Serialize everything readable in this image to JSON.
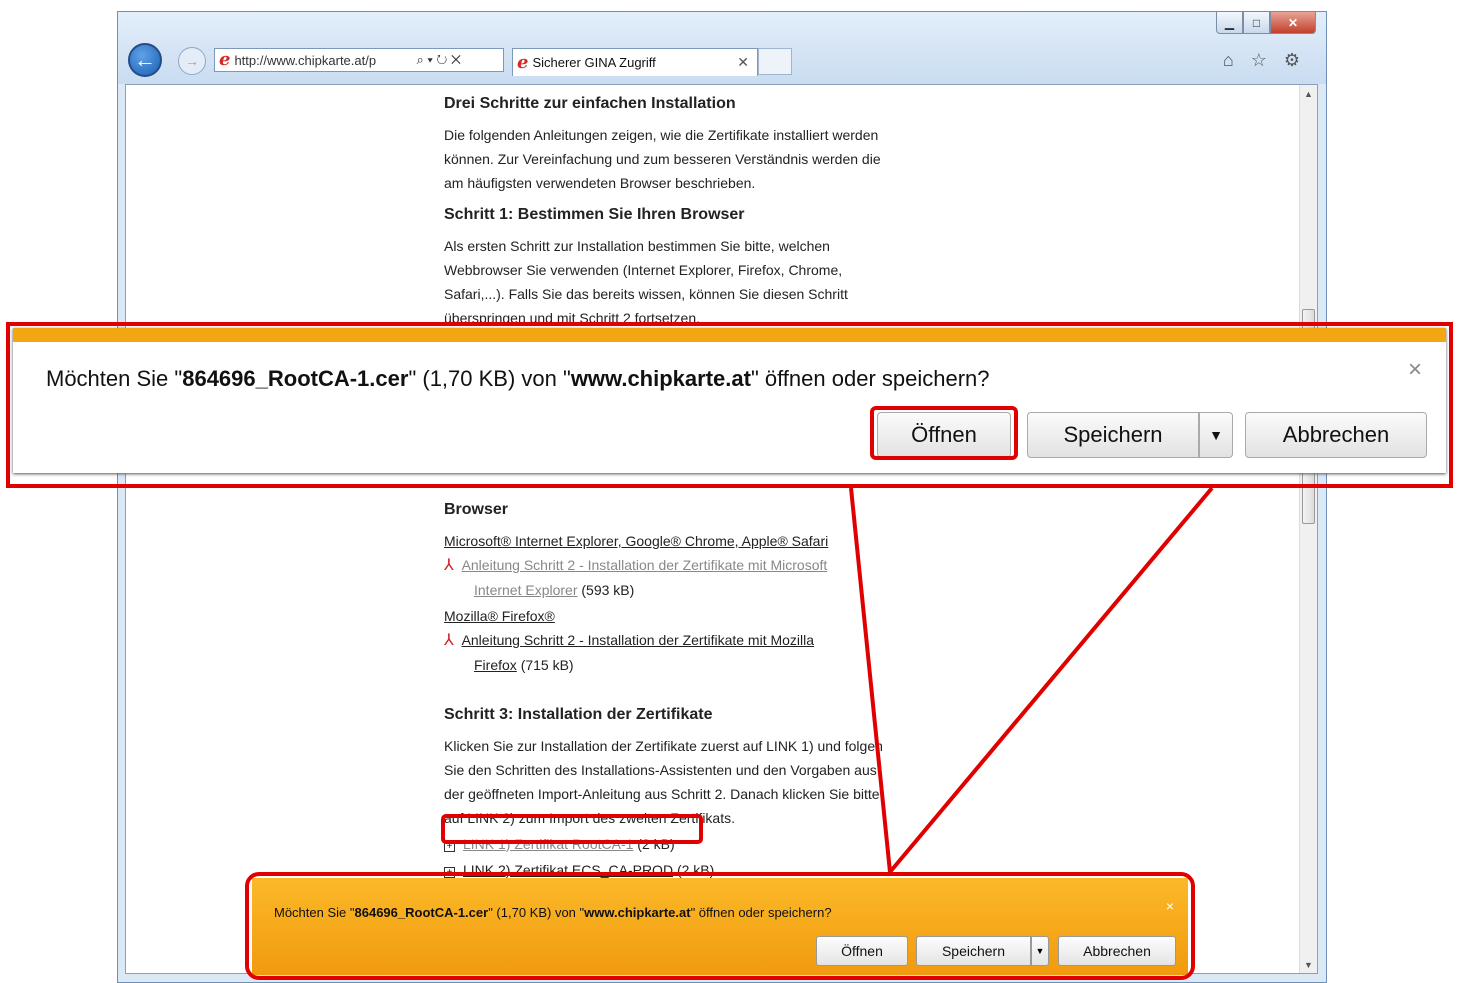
{
  "browser": {
    "url": "http://www.chipkarte.at/p",
    "tab_title": "Sicherer GINA Zugriff",
    "url_icons": "⌕ ▾ ↻ ✕",
    "tool_icons": "⌂ ☆ ⚙"
  },
  "page": {
    "heading_install": "Drei Schritte zur einfachen Installation",
    "intro": [
      "Die folgenden Anleitungen zeigen, wie die Zertifikate installiert werden",
      "können. Zur Vereinfachung und zum besseren Verständnis werden die",
      "am häufigsten verwendeten Browser beschrieben."
    ],
    "step1_heading": "Schritt 1: Bestimmen Sie Ihren Browser",
    "step1_text": [
      "Als ersten Schritt zur Installation bestimmen Sie bitte, welchen",
      "Webbrowser Sie verwenden (Internet Explorer, Firefox, Chrome,",
      "Safari,...). Falls Sie das bereits wissen, können Sie diesen Schritt",
      "überspringen und mit Schritt 2 fortsetzen."
    ],
    "browser_heading": "Browser",
    "ms_browsers": "Microsoft® Internet Explorer, Google® Chrome, Apple® Safari",
    "ms_guide_link_1": "Anleitung Schritt 2 - Installation der Zertifikate mit Microsoft",
    "ms_guide_link_2": "Internet Explorer",
    "ms_guide_size": "(593 kB)",
    "firefox_browser": "Mozilla® Firefox®",
    "ff_guide_link_1": "Anleitung Schritt 2 - Installation der Zertifikate mit Mozilla",
    "ff_guide_link_2": "Firefox",
    "ff_guide_size": "(715 kB)",
    "step3_heading": "Schritt 3: Installation der Zertifikate",
    "step3_text": [
      "Klicken Sie zur Installation der Zertifikate zuerst auf LINK 1) und folgen",
      "Sie den Schritten des Installations-Assistenten und den Vorgaben aus",
      "der geöffneten Import-Anleitung aus Schritt 2. Danach klicken Sie bitte",
      "auf LINK 2) zum Import des zweiten Zertifikats."
    ],
    "link1": "LINK 1) Zertifikat RootCA-1",
    "link1_size": "(2 kB)",
    "link2": "LINK 2) Zertifikat ECS_CA-PROD",
    "link2_size": "(2 kB)"
  },
  "download_prompt": {
    "prefix": "Möchten Sie \"",
    "filename": "864696_RootCA-1.cer",
    "middle": "\" (1,70 KB) von \"",
    "site": "www.chipkarte.at",
    "suffix": "\" öffnen oder speichern?",
    "open_label": "Öffnen",
    "save_label": "Speichern",
    "cancel_label": "Abbrechen",
    "close_symbol": "×"
  },
  "colors": {
    "highlight": "#e00000",
    "notification_orange": "#f2a612"
  }
}
